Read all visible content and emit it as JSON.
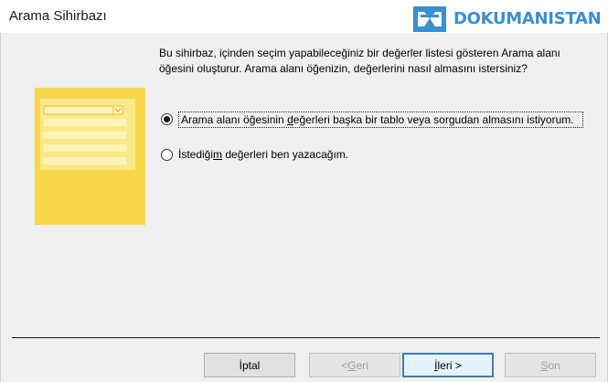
{
  "window": {
    "title": "Arama Sihirbazı",
    "watermark": "DOKUMANISTAN"
  },
  "wizard": {
    "instructions": "Bu sihirbaz, içinden seçim yapabileceğiniz bir değerler listesi gösteren Arama alanı öğesini oluşturur. Arama alanı öğenizin, değerlerini nasıl almasını istersiniz?",
    "options": [
      {
        "label_before": "Arama alanı öğesinin ",
        "label_access": "d",
        "label_after": "eğerleri başka bir tablo veya sorgudan almasını istiyorum.",
        "selected": true
      },
      {
        "label_before": "İstediği",
        "label_access": "m",
        "label_after": " değerleri ben yazacağım.",
        "selected": false
      }
    ]
  },
  "buttons": {
    "cancel": "İptal",
    "back_prefix": "< ",
    "back_access": "G",
    "back_suffix": "eri",
    "next_access": "İ",
    "next_suffix": "leri >",
    "finish_access": "S",
    "finish_suffix": "on"
  },
  "colors": {
    "art_yellow": "#f7d64a",
    "art_light": "#fbe88a",
    "logo_blue": "#3a8fd0",
    "default_button_border": "#3c7fb1"
  }
}
